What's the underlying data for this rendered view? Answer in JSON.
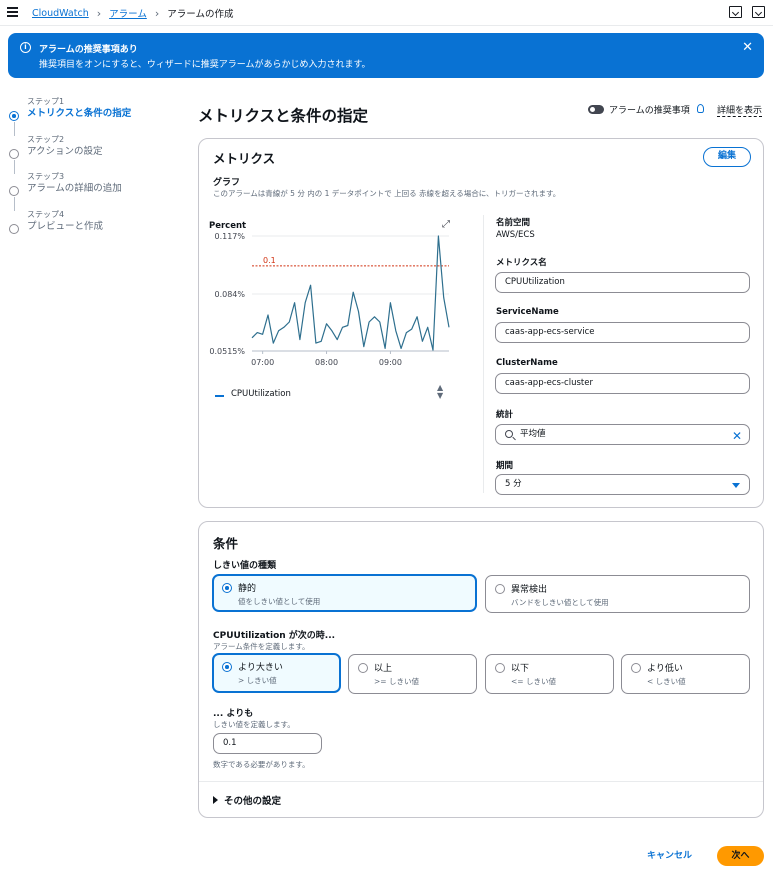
{
  "breadcrumb": {
    "items": [
      "CloudWatch",
      "アラーム",
      "アラームの作成"
    ]
  },
  "flash": {
    "title": "アラームの推奨事項あり",
    "message": "推奨項目をオンにすると、ウィザードに推奨アラームがあらかじめ入力されます。"
  },
  "steps": [
    {
      "num": "ステップ1",
      "label": "メトリクスと条件の指定",
      "active": true
    },
    {
      "num": "ステップ2",
      "label": "アクションの設定",
      "active": false
    },
    {
      "num": "ステップ3",
      "label": "アラームの詳細の追加",
      "active": false
    },
    {
      "num": "ステップ4",
      "label": "プレビューと作成",
      "active": false
    }
  ],
  "header": {
    "title": "メトリクスと条件の指定",
    "toggle_label": "アラームの推奨事項",
    "details_link": "詳細を表示"
  },
  "metrics": {
    "title": "メトリクス",
    "edit_label": "編集",
    "graph_title": "グラフ",
    "graph_desc": "このアラームは青線が 5 分 内の 1 データポイントで 上回る 赤線を超える場合に、トリガーされます。",
    "namespace_label": "名前空間",
    "namespace_value": "AWS/ECS",
    "metric_name_label": "メトリクス名",
    "metric_name_value": "CPUUtilization",
    "service_label": "ServiceName",
    "service_value": "caas-app-ecs-service",
    "cluster_label": "ClusterName",
    "cluster_value": "caas-app-ecs-cluster",
    "stat_label": "統計",
    "stat_value": "平均値",
    "period_label": "期間",
    "period_value": "5 分",
    "legend_label": "CPUUtilization"
  },
  "chart_data": {
    "type": "line",
    "ylabel": "Percent",
    "yticks": [
      "0.117%",
      "0.084%",
      "0.0515%"
    ],
    "ytick_values": [
      0.117,
      0.084,
      0.0515
    ],
    "xticks": [
      "07:00",
      "08:00",
      "09:00"
    ],
    "xtick_times": [
      "07:00",
      "08:00",
      "09:00"
    ],
    "x_range": [
      "06:50",
      "09:55"
    ],
    "ylim": [
      0.0515,
      0.117
    ],
    "threshold": {
      "label": "0.1",
      "value": 0.1,
      "color": "#d13212"
    },
    "series": [
      {
        "name": "CPUUtilization",
        "color": "#2e6f8e",
        "x": [
          "06:50",
          "06:55",
          "07:00",
          "07:05",
          "07:10",
          "07:15",
          "07:20",
          "07:25",
          "07:30",
          "07:35",
          "07:40",
          "07:45",
          "07:50",
          "07:55",
          "08:00",
          "08:05",
          "08:10",
          "08:15",
          "08:20",
          "08:25",
          "08:30",
          "08:35",
          "08:40",
          "08:45",
          "08:50",
          "08:55",
          "09:00",
          "09:05",
          "09:10",
          "09:15",
          "09:20",
          "09:25",
          "09:30",
          "09:35",
          "09:40",
          "09:45",
          "09:50",
          "09:55"
        ],
        "values": [
          0.059,
          0.062,
          0.061,
          0.072,
          0.056,
          0.063,
          0.065,
          0.068,
          0.079,
          0.058,
          0.079,
          0.089,
          0.056,
          0.057,
          0.067,
          0.063,
          0.058,
          0.065,
          0.066,
          0.085,
          0.074,
          0.054,
          0.068,
          0.071,
          0.068,
          0.053,
          0.079,
          0.063,
          0.053,
          0.062,
          0.064,
          0.071,
          0.057,
          0.065,
          0.052,
          0.117,
          0.082,
          0.065
        ]
      }
    ],
    "grid": true
  },
  "conditions": {
    "title": "条件",
    "threshold_type_label": "しきい値の種類",
    "threshold_types": [
      {
        "title": "静的",
        "desc": "値をしきい値として使用",
        "selected": true
      },
      {
        "title": "異常検出",
        "desc": "バンドをしきい値として使用",
        "selected": false
      }
    ],
    "when_label": "CPUUtilization が次の時...",
    "when_desc": "アラーム条件を定義します。",
    "operators": [
      {
        "title": "より大きい",
        "desc": "> しきい値",
        "selected": true
      },
      {
        "title": "以上",
        "desc": ">= しきい値",
        "selected": false
      },
      {
        "title": "以下",
        "desc": "<= しきい値",
        "selected": false
      },
      {
        "title": "より低い",
        "desc": "< しきい値",
        "selected": false
      }
    ],
    "than_label": "... よりも",
    "than_desc": "しきい値を定義します。",
    "threshold_value": "0.1",
    "threshold_hint": "数字である必要があります。",
    "additional_label": "その他の設定"
  },
  "footer": {
    "cancel_label": "キャンセル",
    "next_label": "次へ"
  },
  "colors": {
    "accent": "#0972d3",
    "primary_button": "#ff9900",
    "threshold": "#d13212"
  }
}
